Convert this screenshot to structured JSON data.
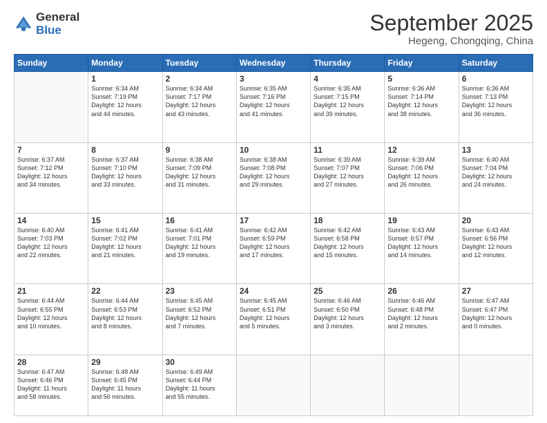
{
  "logo": {
    "general": "General",
    "blue": "Blue"
  },
  "header": {
    "month": "September 2025",
    "location": "Hegeng, Chongqing, China"
  },
  "weekdays": [
    "Sunday",
    "Monday",
    "Tuesday",
    "Wednesday",
    "Thursday",
    "Friday",
    "Saturday"
  ],
  "weeks": [
    [
      {
        "day": "",
        "info": ""
      },
      {
        "day": "1",
        "info": "Sunrise: 6:34 AM\nSunset: 7:19 PM\nDaylight: 12 hours\nand 44 minutes."
      },
      {
        "day": "2",
        "info": "Sunrise: 6:34 AM\nSunset: 7:17 PM\nDaylight: 12 hours\nand 43 minutes."
      },
      {
        "day": "3",
        "info": "Sunrise: 6:35 AM\nSunset: 7:16 PM\nDaylight: 12 hours\nand 41 minutes."
      },
      {
        "day": "4",
        "info": "Sunrise: 6:35 AM\nSunset: 7:15 PM\nDaylight: 12 hours\nand 39 minutes."
      },
      {
        "day": "5",
        "info": "Sunrise: 6:36 AM\nSunset: 7:14 PM\nDaylight: 12 hours\nand 38 minutes."
      },
      {
        "day": "6",
        "info": "Sunrise: 6:36 AM\nSunset: 7:13 PM\nDaylight: 12 hours\nand 36 minutes."
      }
    ],
    [
      {
        "day": "7",
        "info": "Sunrise: 6:37 AM\nSunset: 7:12 PM\nDaylight: 12 hours\nand 34 minutes."
      },
      {
        "day": "8",
        "info": "Sunrise: 6:37 AM\nSunset: 7:10 PM\nDaylight: 12 hours\nand 33 minutes."
      },
      {
        "day": "9",
        "info": "Sunrise: 6:38 AM\nSunset: 7:09 PM\nDaylight: 12 hours\nand 31 minutes."
      },
      {
        "day": "10",
        "info": "Sunrise: 6:38 AM\nSunset: 7:08 PM\nDaylight: 12 hours\nand 29 minutes."
      },
      {
        "day": "11",
        "info": "Sunrise: 6:39 AM\nSunset: 7:07 PM\nDaylight: 12 hours\nand 27 minutes."
      },
      {
        "day": "12",
        "info": "Sunrise: 6:39 AM\nSunset: 7:06 PM\nDaylight: 12 hours\nand 26 minutes."
      },
      {
        "day": "13",
        "info": "Sunrise: 6:40 AM\nSunset: 7:04 PM\nDaylight: 12 hours\nand 24 minutes."
      }
    ],
    [
      {
        "day": "14",
        "info": "Sunrise: 6:40 AM\nSunset: 7:03 PM\nDaylight: 12 hours\nand 22 minutes."
      },
      {
        "day": "15",
        "info": "Sunrise: 6:41 AM\nSunset: 7:02 PM\nDaylight: 12 hours\nand 21 minutes."
      },
      {
        "day": "16",
        "info": "Sunrise: 6:41 AM\nSunset: 7:01 PM\nDaylight: 12 hours\nand 19 minutes."
      },
      {
        "day": "17",
        "info": "Sunrise: 6:42 AM\nSunset: 6:59 PM\nDaylight: 12 hours\nand 17 minutes."
      },
      {
        "day": "18",
        "info": "Sunrise: 6:42 AM\nSunset: 6:58 PM\nDaylight: 12 hours\nand 15 minutes."
      },
      {
        "day": "19",
        "info": "Sunrise: 6:43 AM\nSunset: 6:57 PM\nDaylight: 12 hours\nand 14 minutes."
      },
      {
        "day": "20",
        "info": "Sunrise: 6:43 AM\nSunset: 6:56 PM\nDaylight: 12 hours\nand 12 minutes."
      }
    ],
    [
      {
        "day": "21",
        "info": "Sunrise: 6:44 AM\nSunset: 6:55 PM\nDaylight: 12 hours\nand 10 minutes."
      },
      {
        "day": "22",
        "info": "Sunrise: 6:44 AM\nSunset: 6:53 PM\nDaylight: 12 hours\nand 8 minutes."
      },
      {
        "day": "23",
        "info": "Sunrise: 6:45 AM\nSunset: 6:52 PM\nDaylight: 12 hours\nand 7 minutes."
      },
      {
        "day": "24",
        "info": "Sunrise: 6:45 AM\nSunset: 6:51 PM\nDaylight: 12 hours\nand 5 minutes."
      },
      {
        "day": "25",
        "info": "Sunrise: 6:46 AM\nSunset: 6:50 PM\nDaylight: 12 hours\nand 3 minutes."
      },
      {
        "day": "26",
        "info": "Sunrise: 6:46 AM\nSunset: 6:48 PM\nDaylight: 12 hours\nand 2 minutes."
      },
      {
        "day": "27",
        "info": "Sunrise: 6:47 AM\nSunset: 6:47 PM\nDaylight: 12 hours\nand 0 minutes."
      }
    ],
    [
      {
        "day": "28",
        "info": "Sunrise: 6:47 AM\nSunset: 6:46 PM\nDaylight: 11 hours\nand 58 minutes."
      },
      {
        "day": "29",
        "info": "Sunrise: 6:48 AM\nSunset: 6:45 PM\nDaylight: 11 hours\nand 56 minutes."
      },
      {
        "day": "30",
        "info": "Sunrise: 6:49 AM\nSunset: 6:44 PM\nDaylight: 11 hours\nand 55 minutes."
      },
      {
        "day": "",
        "info": ""
      },
      {
        "day": "",
        "info": ""
      },
      {
        "day": "",
        "info": ""
      },
      {
        "day": "",
        "info": ""
      }
    ]
  ]
}
